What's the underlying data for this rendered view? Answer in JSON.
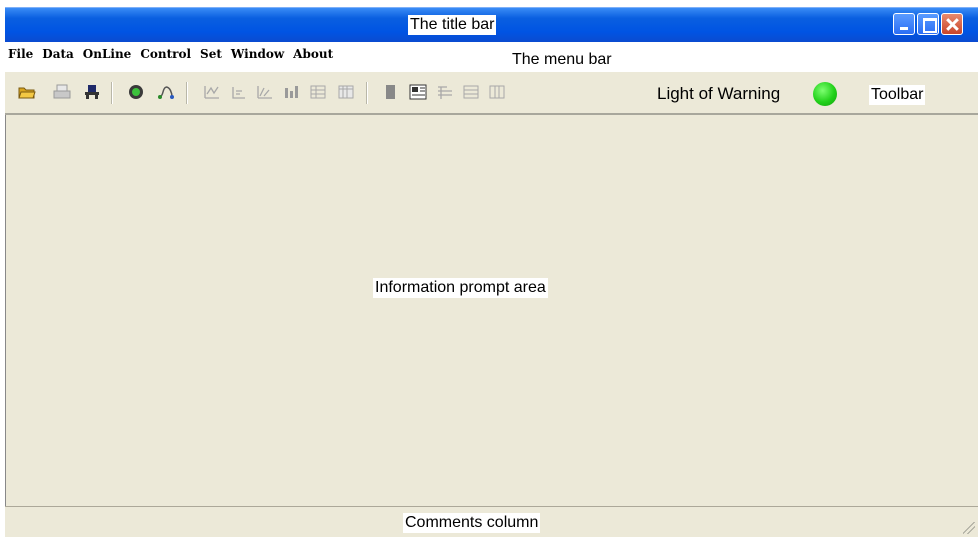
{
  "titlebar": {
    "label": "The title bar"
  },
  "menubar": {
    "items": [
      "File",
      "Data",
      "OnLine",
      "Control",
      "Set",
      "Window",
      "About"
    ],
    "label": "The menu bar"
  },
  "toolbar": {
    "warning_label": "Light of Warning",
    "warning_color": "#22d11a",
    "label": "Toolbar",
    "icons": [
      "open-folder-icon",
      "print-icon",
      "connect-icon",
      "record-icon",
      "link-icon",
      "chart-icon-1",
      "chart-icon-2",
      "chart-icon-3",
      "chart-icon-4",
      "grid-icon",
      "table-icon",
      "bar-icon",
      "panel-icon",
      "list-icon",
      "window-icon",
      "columns-icon"
    ]
  },
  "main": {
    "label": "Information prompt area"
  },
  "statusbar": {
    "label": "Comments column"
  },
  "colors": {
    "titlebar": "#0054e3",
    "window_bg": "#ece9d8",
    "warning_light": "#22d11a"
  }
}
